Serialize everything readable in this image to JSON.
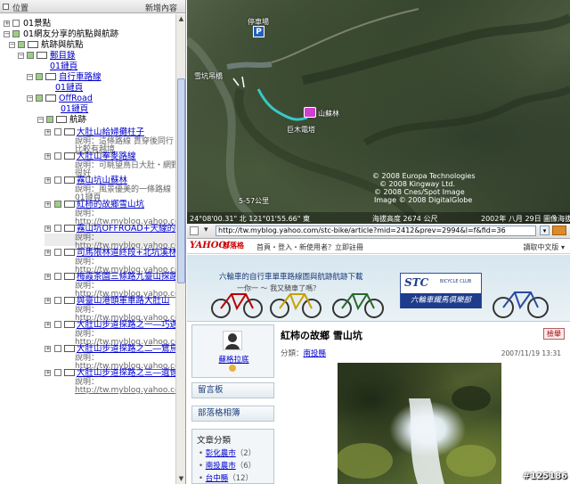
{
  "left_panel": {
    "title": "位置",
    "add_link": "新增內容",
    "rows": [
      {
        "label": "01景點"
      },
      {
        "label": "01網友分享的航點與航跡"
      },
      {
        "label": "航跡與航點"
      },
      {
        "label": "郵目錄"
      },
      {
        "label": "01鏈頁"
      },
      {
        "label": "自行車路線"
      },
      {
        "label": "01鏈頁"
      },
      {
        "label": "OffRoad"
      },
      {
        "label": "01鏈頁"
      },
      {
        "label": "航跡"
      }
    ],
    "tracks": [
      {
        "title": "大肚山給婦攤柱子",
        "desc1": "說明：這條路線 貫穿後同行",
        "desc2": "比較有越境"
      },
      {
        "title": "大肚山拳麥路線",
        "desc1": "說明：可眺望鳥日大肚・網野",
        "desc2": "很好"
      },
      {
        "title": "霧山坑山蘇林",
        "desc1": "說明：風景優美的一條路線",
        "desc2": "01鏈頁"
      },
      {
        "title": "紅柿的故鄉雪山坑",
        "desc1": "說明：",
        "desc2": "http://tw.myblog.yahoo.com/stc-"
      },
      {
        "title": "霧山坑OFFROAD+天線的司馬",
        "desc1": "說明：",
        "desc2": "http://tw.myblog.yahoo.com/stc-"
      },
      {
        "title": "司馬限林道終段+北坑溪林道",
        "desc1": "說明：",
        "desc2": "http://tw.myblog.yahoo.com/stc-"
      },
      {
        "title": "梅霞茶園三條路九臺山探路",
        "desc1": "說明：",
        "desc2": "http://tw.myblog.yahoo.com/stc-"
      },
      {
        "title": "與臺山港頭軍車路大肚山",
        "desc1": "說明：",
        "desc2": "http://tw.myblog.yahoo.com/stc-"
      },
      {
        "title": "大肚山步道探路之一―巧遇",
        "desc1": "說明：",
        "desc2": "http://tw.myblog.yahoo.com/stc-"
      },
      {
        "title": "大肚山步道探路之二―鷺鳥",
        "desc1": "說明：",
        "desc2": "http://tw.myblog.yahoo.com/stc-"
      },
      {
        "title": "大肚山步道探路之三―遺憾",
        "desc1": "說明：",
        "desc2": "http://tw.myblog.yahoo.com/stc-"
      }
    ]
  },
  "map": {
    "labels": {
      "parking": "停車場",
      "bridge": "雪坑吊橋",
      "forest": "山蘇林",
      "dam": "巨木電塔",
      "river": "5-57公里"
    },
    "copyright": [
      "© 2008 Europa Technologies",
      "© 2008 Kingway Ltd.",
      "© 2008 Cnes/Spot Image",
      "Image © 2008 DigitalGlobe"
    ],
    "status_left": "24°08'00.31\" 北   121°01'55.66\" 東",
    "status_mid": "海拔高度 2674 公尺",
    "status_right": "2002年 八月 29日 圖像海拔高度"
  },
  "browser": {
    "url": "http://tw.myblog.yahoo.com/stc-bike/article?mid=2412&prev=2994&l=f&fid=36",
    "yahoo_logo": "YAHOO!",
    "yahoo_sub": "奇摩",
    "blog_label": "部落格",
    "nav": "首頁・登入・新使用者？立即註冊",
    "nav_right": "讀取中文版 ▾",
    "banner_line1": "六輪車的自行車單車路線圖與航跡航跡下載",
    "banner_line2": "一你一 ～ 我又騎車了嗎？",
    "stc_logo": "STC",
    "stc_club": "BICYCLE CLUB",
    "stc_slogan": "六輪車鐵馬俱樂部",
    "profile_name": "蘇格拉底",
    "btn_guestbook": "留言板",
    "btn_links": "部落格相簿",
    "cat_title": "文章分類",
    "categories": [
      {
        "name": "彰化農市",
        "count": "（2）"
      },
      {
        "name": "南投農市",
        "count": "（6）"
      },
      {
        "name": "台中縣",
        "count": "（12）"
      }
    ],
    "article_title": "紅柿の故鄉 雪山坑",
    "article_btn": "檢舉",
    "article_cat_label": "分類：",
    "article_cat": "南投縣",
    "article_date": "2007/11/19 13:31"
  },
  "watermark": "#125186"
}
